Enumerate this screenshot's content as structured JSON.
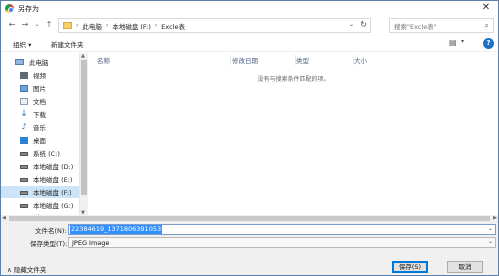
{
  "window": {
    "title": "另存为",
    "close": "✕"
  },
  "nav": {
    "back": "←",
    "forward": "→",
    "recent": "⌄",
    "up": "↑",
    "breadcrumb": [
      "此电脑",
      "本地磁盘 (F:)",
      "Excle表"
    ],
    "separator": "›",
    "dropdown": "⌄",
    "refresh": "↻",
    "search_placeholder": "搜索\"Excle表\"",
    "search_icon": "⌕"
  },
  "toolbar": {
    "organize": "组织 ▾",
    "new_folder": "新建文件夹",
    "view_icon": "▤",
    "view_dropdown": "▾",
    "help": "?"
  },
  "sidebar": {
    "items": [
      {
        "label": "此电脑",
        "icon": "computer-icon"
      },
      {
        "label": "视频",
        "icon": "video-icon"
      },
      {
        "label": "图片",
        "icon": "picture-icon"
      },
      {
        "label": "文档",
        "icon": "document-icon"
      },
      {
        "label": "下载",
        "icon": "download-icon"
      },
      {
        "label": "音乐",
        "icon": "music-icon"
      },
      {
        "label": "桌面",
        "icon": "desktop-icon"
      },
      {
        "label": "系统 (C:)",
        "icon": "drive-icon"
      },
      {
        "label": "本地磁盘 (D:)",
        "icon": "drive-icon"
      },
      {
        "label": "本地磁盘 (E:)",
        "icon": "drive-icon"
      },
      {
        "label": "本地磁盘 (F:)",
        "icon": "drive-icon",
        "selected": true
      },
      {
        "label": "本地磁盘 (G:)",
        "icon": "drive-icon"
      },
      {
        "label": "网络",
        "icon": "network-icon"
      }
    ]
  },
  "filelist": {
    "columns": [
      "名称",
      "修改日期",
      "类型",
      "大小"
    ],
    "empty_message": "没有与搜索条件匹配的项。"
  },
  "form": {
    "filename_label": "文件名(N):",
    "filename_value": "22384619_1371806391053",
    "filetype_label": "保存类型(T):",
    "filetype_value": "JPEG Image",
    "hide_folders": "∧ 隐藏文件夹",
    "save": "保存(S)",
    "cancel": "取消"
  },
  "colors": {
    "accent": "#0078d7",
    "selection": "#3390ff",
    "sidebar_selected": "#cce4f7"
  }
}
